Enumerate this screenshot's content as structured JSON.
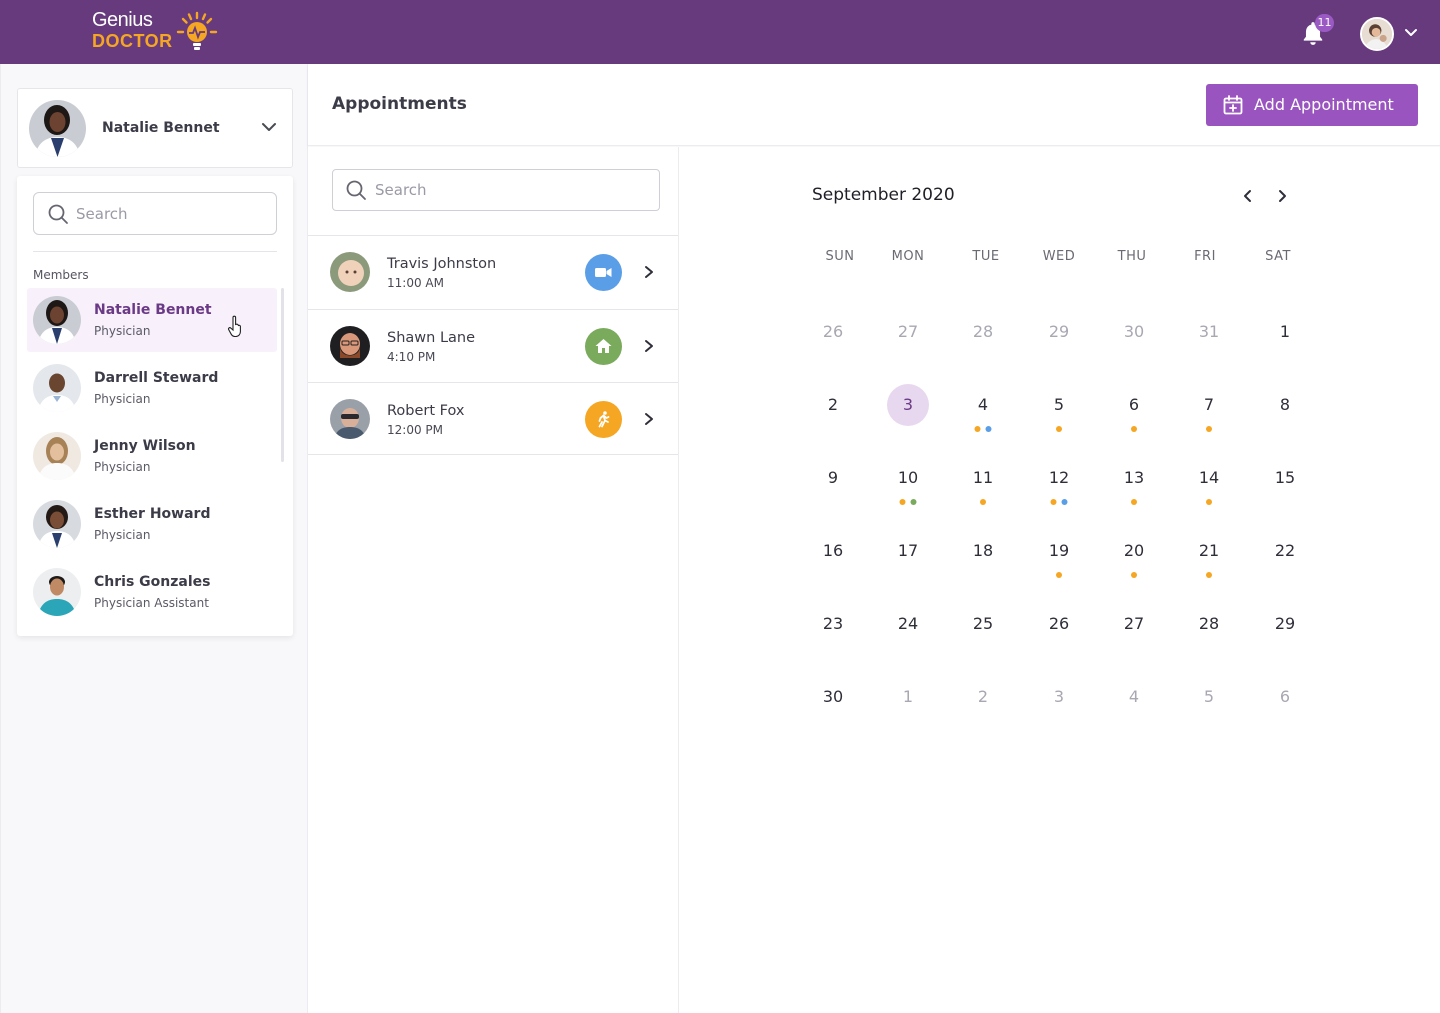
{
  "app": {
    "logo_line1": "Genius",
    "logo_line2": "DOCTOR",
    "notification_count": "11"
  },
  "colors": {
    "topbar": "#663a7c",
    "accent": "#9a54bf",
    "video": "#5b9ee8",
    "home": "#7aaa5c",
    "walkin": "#f5a623",
    "dot_orange": "#f5a623",
    "dot_blue": "#5b9ee8",
    "dot_green": "#7aaa5c"
  },
  "selected_user": {
    "name": "Natalie Bennet"
  },
  "members": {
    "search_placeholder": "Search",
    "heading": "Members",
    "items": [
      {
        "name": "Natalie Bennet",
        "role": "Physician",
        "active": true
      },
      {
        "name": "Darrell Steward",
        "role": "Physician",
        "active": false
      },
      {
        "name": "Jenny Wilson",
        "role": "Physician",
        "active": false
      },
      {
        "name": "Esther Howard",
        "role": "Physician",
        "active": false
      },
      {
        "name": "Chris Gonzales",
        "role": "Physician Assistant",
        "active": false
      }
    ]
  },
  "header": {
    "title": "Appointments",
    "add_button": "Add Appointment"
  },
  "appointments": {
    "search_placeholder": "Search",
    "items": [
      {
        "name": "Travis Johnston",
        "time": "11:00 AM",
        "type": "video-icon"
      },
      {
        "name": "Shawn Lane",
        "time": "4:10 PM",
        "type": "home-icon"
      },
      {
        "name": "Robert Fox",
        "time": "12:00 PM",
        "type": "walk-in-icon"
      }
    ]
  },
  "calendar": {
    "month_label": "September 2020",
    "weekdays": [
      "SUN",
      "MON",
      "TUE",
      "WED",
      "THU",
      "FRI",
      "SAT"
    ],
    "selected_day": 3,
    "weeks": [
      [
        {
          "d": "26",
          "muted": true
        },
        {
          "d": "27",
          "muted": true
        },
        {
          "d": "28",
          "muted": true
        },
        {
          "d": "29",
          "muted": true
        },
        {
          "d": "30",
          "muted": true
        },
        {
          "d": "31",
          "muted": true
        },
        {
          "d": "1"
        }
      ],
      [
        {
          "d": "2"
        },
        {
          "d": "3",
          "today": true
        },
        {
          "d": "4",
          "dots": [
            "orange",
            "blue"
          ]
        },
        {
          "d": "5",
          "dots": [
            "orange"
          ]
        },
        {
          "d": "6",
          "dots": [
            "orange"
          ]
        },
        {
          "d": "7",
          "dots": [
            "orange"
          ]
        },
        {
          "d": "8"
        }
      ],
      [
        {
          "d": "9"
        },
        {
          "d": "10",
          "dots": [
            "orange",
            "green"
          ]
        },
        {
          "d": "11",
          "dots": [
            "orange"
          ]
        },
        {
          "d": "12",
          "dots": [
            "orange",
            "blue"
          ]
        },
        {
          "d": "13",
          "dots": [
            "orange"
          ]
        },
        {
          "d": "14",
          "dots": [
            "orange"
          ]
        },
        {
          "d": "15"
        }
      ],
      [
        {
          "d": "16"
        },
        {
          "d": "17"
        },
        {
          "d": "18"
        },
        {
          "d": "19",
          "dots": [
            "orange"
          ]
        },
        {
          "d": "20",
          "dots": [
            "orange"
          ]
        },
        {
          "d": "21",
          "dots": [
            "orange"
          ]
        },
        {
          "d": "22"
        }
      ],
      [
        {
          "d": "23"
        },
        {
          "d": "24"
        },
        {
          "d": "25"
        },
        {
          "d": "26"
        },
        {
          "d": "27"
        },
        {
          "d": "28"
        },
        {
          "d": "29"
        }
      ],
      [
        {
          "d": "30"
        },
        {
          "d": "1",
          "muted": true
        },
        {
          "d": "2",
          "muted": true
        },
        {
          "d": "3",
          "muted": true
        },
        {
          "d": "4",
          "muted": true
        },
        {
          "d": "5",
          "muted": true
        },
        {
          "d": "6",
          "muted": true
        }
      ]
    ]
  }
}
